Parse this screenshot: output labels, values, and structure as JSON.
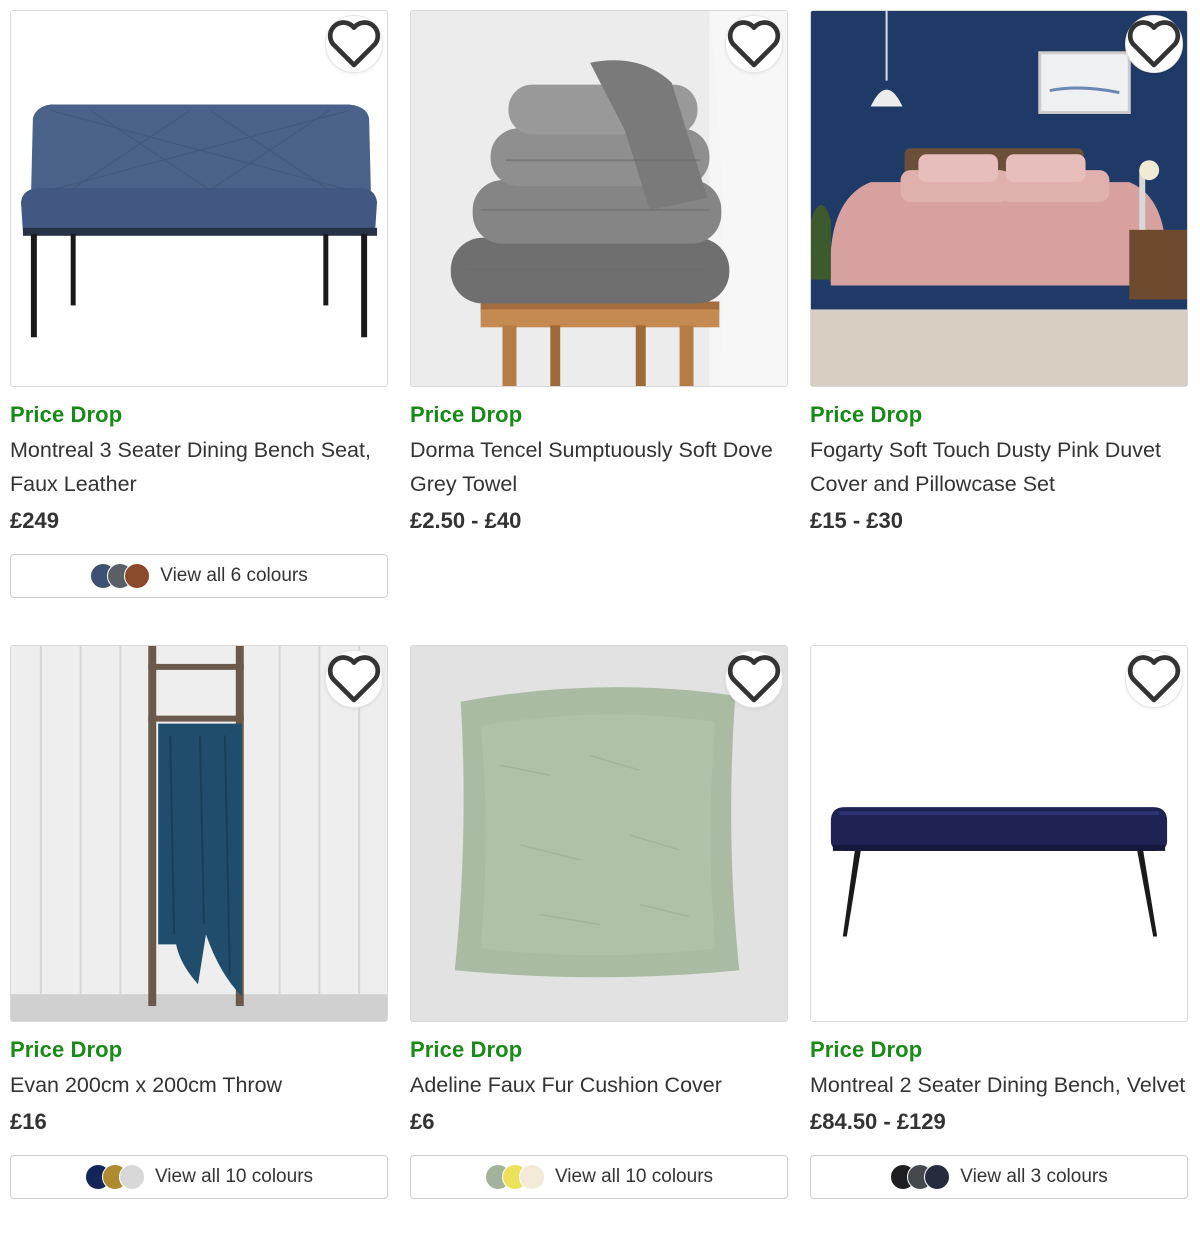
{
  "products": [
    {
      "badge": "Price Drop",
      "name": "Montreal 3 Seater Dining Bench Seat, Faux Leather",
      "price": "£249",
      "colours_label": "View all 6 colours",
      "swatches": [
        "#3d5272",
        "#5a5f66",
        "#8a4a2b"
      ]
    },
    {
      "badge": "Price Drop",
      "name": "Dorma Tencel Sumptuously Soft Dove Grey Towel",
      "price": "£2.50 - £40"
    },
    {
      "badge": "Price Drop",
      "name": "Fogarty Soft Touch Dusty Pink Duvet Cover and Pillowcase Set",
      "price": "£15 - £30"
    },
    {
      "badge": "Price Drop",
      "name": "Evan 200cm x 200cm Throw",
      "price": "£16",
      "colours_label": "View all 10 colours",
      "swatches": [
        "#14255a",
        "#b08a2e",
        "#d8d8d8"
      ]
    },
    {
      "badge": "Price Drop",
      "name": "Adeline Faux Fur Cushion Cover",
      "price": "£6",
      "colours_label": "View all 10 colours",
      "swatches": [
        "#a3b39b",
        "#ece15a",
        "#f3ead8"
      ]
    },
    {
      "badge": "Price Drop",
      "name": "Montreal 2 Seater Dining Bench, Velvet",
      "price": "£84.50 - £129",
      "colours_label": "View all 3 colours",
      "swatches": [
        "#1f1f22",
        "#45484d",
        "#262c3e"
      ]
    }
  ],
  "icons": {
    "favourite": "heart-outline-icon"
  },
  "colors": {
    "badge_green": "#178a17",
    "text": "#333333",
    "border": "#d9d9d9"
  }
}
